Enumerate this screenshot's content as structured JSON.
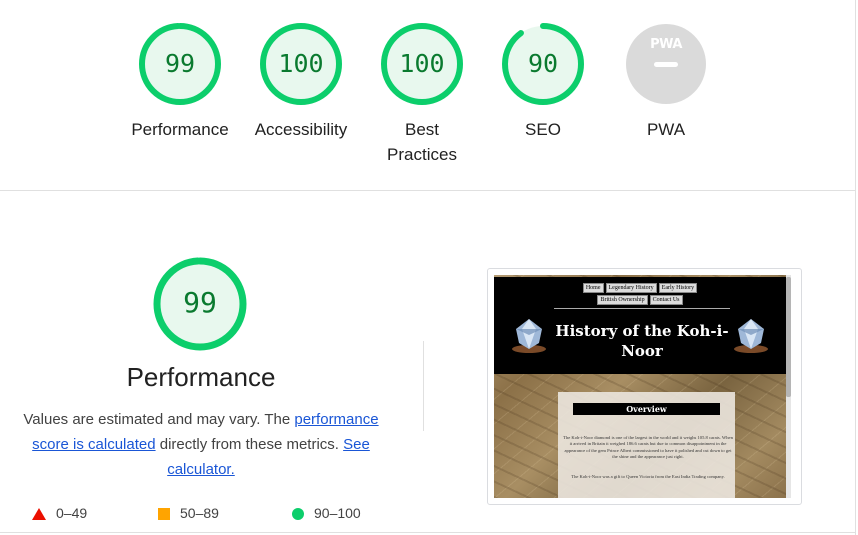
{
  "gauges": [
    {
      "score": "99",
      "label": "Performance",
      "value": 0.99,
      "color": "#0cce6b"
    },
    {
      "score": "100",
      "label": "Accessibility",
      "value": 1.0,
      "color": "#0cce6b"
    },
    {
      "score": "100",
      "label_line1": "Best",
      "label_line2": "Practices",
      "value": 1.0,
      "color": "#0cce6b"
    },
    {
      "score": "90",
      "label": "SEO",
      "value": 0.9,
      "color": "#0cce6b"
    },
    {
      "badge": "PWA",
      "label": "PWA",
      "color": "#dadada"
    }
  ],
  "performance": {
    "score": "99",
    "value": 0.99,
    "title": "Performance",
    "desc_prefix": "Values are estimated and may vary. The ",
    "desc_link1": "performance score is calculated",
    "desc_middle": " directly from these metrics. ",
    "desc_link2": "See calculator."
  },
  "legend": [
    {
      "range": "0–49",
      "color": "#eb0f00",
      "icon": "triangle-icon"
    },
    {
      "range": "50–89",
      "color": "#ffa400",
      "icon": "square-icon"
    },
    {
      "range": "90–100",
      "color": "#0cce6b",
      "icon": "circle-icon"
    }
  ],
  "screenshot": {
    "nav": [
      "Home",
      "Legendary History",
      "Early History",
      "British Ownership",
      "Contact Us"
    ],
    "title_line1": "History of the Koh-i-",
    "title_line2": "Noor",
    "overview_heading": "Overview",
    "para1": "The Koh-i-Noor diamond is one of the largest in the world and it weighs 105.8 carats. When it arrived in Britain it weighed 186.6 carats but due to common disappointment in the appearance of the gem Prince Albert commissioned to have it polished and cut down to get the shine and the appearance just right.",
    "para2": "The Koh-i-Noor was a gift to Queen Victoria from the East India Trading company."
  }
}
